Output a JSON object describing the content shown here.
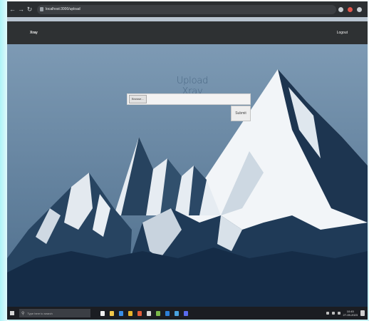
{
  "browser": {
    "url": "localhost:3000/upload",
    "back_icon": "back-arrow-icon",
    "forward_icon": "forward-arrow-icon",
    "reload_icon": "reload-icon"
  },
  "navbar": {
    "brand": "Xray",
    "logout": "Logout"
  },
  "main": {
    "title": "Upload Xray",
    "file_input": {
      "button_label": "Browse...",
      "value": ""
    },
    "submit_label": "Submit"
  },
  "taskbar": {
    "search_placeholder": "Type here to search",
    "time": "10:45",
    "date": "27-09-2023"
  },
  "colors": {
    "navbar_bg": "#2e3133",
    "sky": "#5f7f9c",
    "mountain_dark": "#1d3550",
    "snow": "#f2f5f8"
  }
}
